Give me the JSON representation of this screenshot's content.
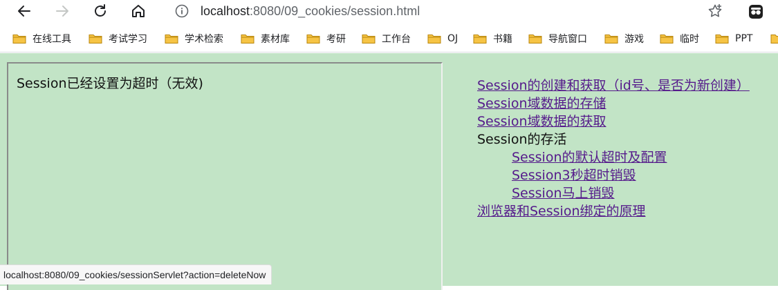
{
  "browser": {
    "url_host": "localhost",
    "url_rest": ":8080/09_cookies/session.html",
    "icons": {
      "back": "back-arrow-icon",
      "forward": "forward-arrow-icon",
      "reload": "reload-icon",
      "home": "home-icon",
      "site_info": "info-icon",
      "bookmark_star": "star-icon",
      "extension": "extension-icon"
    }
  },
  "bookmarks": [
    {
      "label": "在线工具"
    },
    {
      "label": "考试学习"
    },
    {
      "label": "学术检索"
    },
    {
      "label": "素材库"
    },
    {
      "label": "考研"
    },
    {
      "label": "工作台"
    },
    {
      "label": "OJ"
    },
    {
      "label": "书籍"
    },
    {
      "label": "导航窗口"
    },
    {
      "label": "游戏"
    },
    {
      "label": "临时"
    },
    {
      "label": "PPT"
    }
  ],
  "frame": {
    "message": "Session已经设置为超时（无效)"
  },
  "menu": {
    "links_top": [
      {
        "label": "Session的创建和获取（id号、是否为新创建）"
      },
      {
        "label": "Session域数据的存储"
      },
      {
        "label": "Session域数据的获取"
      }
    ],
    "group_label": "Session的存活",
    "sub_links": [
      {
        "label": "Session的默认超时及配置"
      },
      {
        "label": "Session3秒超时销毁"
      },
      {
        "label": "Session马上销毁"
      }
    ],
    "link_bottom": {
      "label": "浏览器和Session绑定的原理"
    }
  },
  "status_bar": {
    "text": "localhost:8080/09_cookies/sessionServlet?action=deleteNow"
  },
  "colors": {
    "page_background": "#c2e4c6",
    "visited_link": "#551a8b",
    "folder": "#f6c445"
  }
}
